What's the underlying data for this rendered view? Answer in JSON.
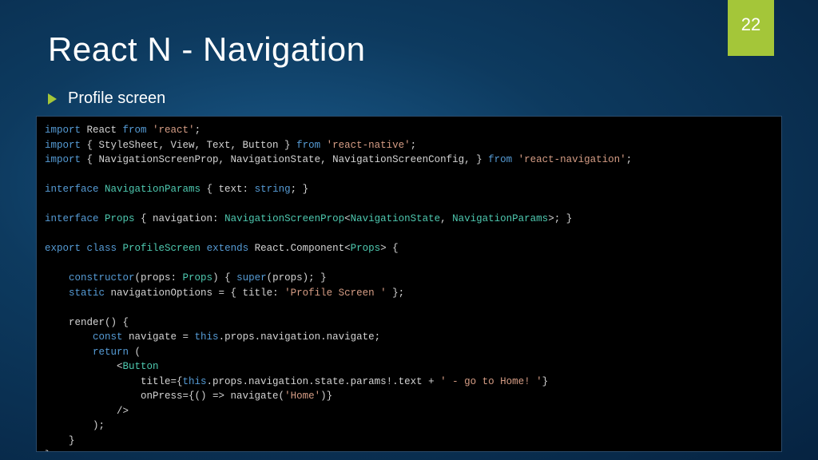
{
  "slide": {
    "title": "React N - Navigation",
    "page_number": "22",
    "bullet": "Profile screen"
  },
  "code": {
    "l1": {
      "a": "import",
      "b": " React ",
      "c": "from",
      "d": " 'react'",
      "e": ";"
    },
    "l2": {
      "a": "import",
      "b": " { StyleSheet, View, Text, Button } ",
      "c": "from",
      "d": " 'react-native'",
      "e": ";"
    },
    "l3": {
      "a": "import",
      "b": " { NavigationScreenProp, NavigationState, NavigationScreenConfig, } ",
      "c": "from",
      "d": " 'react-navigation'",
      "e": ";"
    },
    "l5": {
      "a": "interface",
      "b": " NavigationParams",
      "c": " { text: ",
      "d": "string",
      "e": "; }"
    },
    "l7": {
      "a": "interface",
      "b": " Props",
      "c": " { navigation: ",
      "d": "NavigationScreenProp",
      "e": "<",
      "f": "NavigationState",
      "g": ", ",
      "h": "NavigationParams",
      "i": ">; }"
    },
    "l9": {
      "a": "export",
      "b": " class",
      "c": " ProfileScreen",
      "d": " extends",
      "e": " React.Component<",
      "f": "Props",
      "g": "> {"
    },
    "l11": {
      "a": "    ",
      "b": "constructor",
      "c": "(props: ",
      "d": "Props",
      "e": ") { ",
      "f": "super",
      "g": "(props); }"
    },
    "l12": {
      "a": "    ",
      "b": "static",
      "c": " navigationOptions = { title: ",
      "d": "'Profile Screen '",
      "e": " };"
    },
    "l14": {
      "a": "    render() {"
    },
    "l15": {
      "a": "        ",
      "b": "const",
      "c": " navigate = ",
      "d": "this",
      "e": ".props.navigation.navigate;"
    },
    "l16": {
      "a": "        ",
      "b": "return",
      "c": " ("
    },
    "l17": {
      "a": "            <",
      "b": "Button"
    },
    "l18": {
      "a": "                title={",
      "b": "this",
      "c": ".props.navigation.state.params!.text + ",
      "d": "' - go to Home! '",
      "e": "}"
    },
    "l19": {
      "a": "                onPress={() => navigate(",
      "b": "'Home'",
      "c": ")}"
    },
    "l20": {
      "a": "            />"
    },
    "l21": {
      "a": "        );"
    },
    "l22": {
      "a": "    }"
    },
    "l23": {
      "a": "}"
    }
  }
}
